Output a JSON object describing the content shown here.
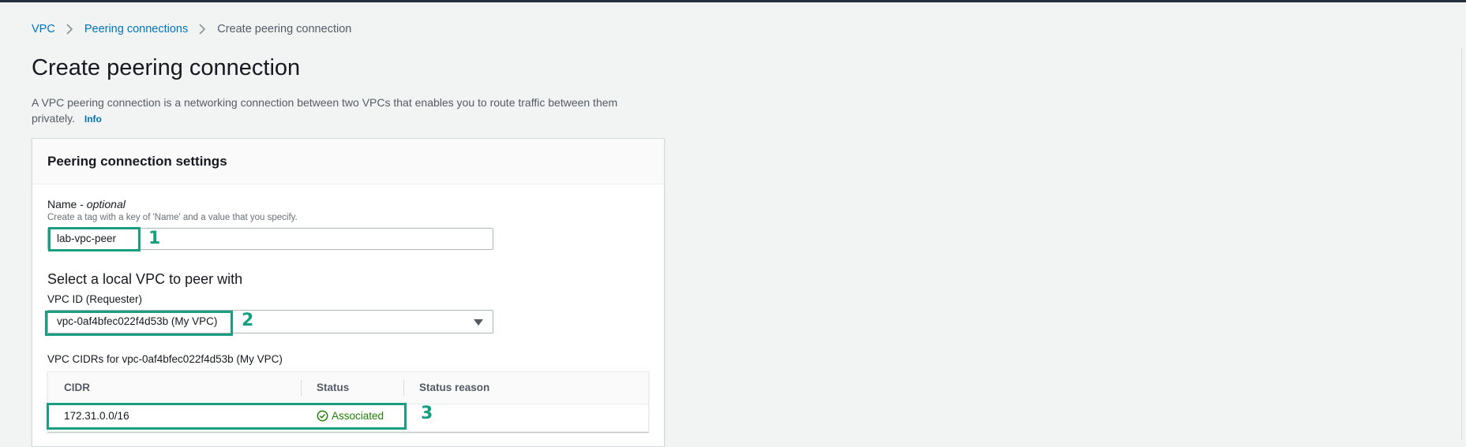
{
  "breadcrumb": {
    "items": [
      "VPC",
      "Peering connections"
    ],
    "current": "Create peering connection"
  },
  "page": {
    "title": "Create peering connection",
    "description": "A VPC peering connection is a networking connection between two VPCs that enables you to route traffic between them privately.",
    "info_link": "Info"
  },
  "panel": {
    "title": "Peering connection settings",
    "name_label": "Name - ",
    "name_optional": "optional",
    "name_hint": "Create a tag with a key of 'Name' and a value that you specify.",
    "name_value": "lab-vpc-peer",
    "local_vpc_heading": "Select a local VPC to peer with",
    "vpc_id_label": "VPC ID (Requester)",
    "vpc_id_value": "vpc-0af4bfec022f4d53b (My VPC)",
    "cidrs_label": "VPC CIDRs for vpc-0af4bfec022f4d53b (My VPC)",
    "table": {
      "headers": [
        "CIDR",
        "Status",
        "Status reason"
      ],
      "rows": [
        {
          "cidr": "172.31.0.0/16",
          "status": "Associated",
          "status_reason": ""
        }
      ]
    }
  },
  "annotations": [
    "1",
    "2",
    "3"
  ],
  "colors": {
    "annotation": "#1a9e82",
    "link": "#0073bb",
    "status_ok": "#1d8102",
    "topbar": "#232f3e"
  },
  "icons": [
    "chevron-right-icon",
    "caret-down-icon",
    "check-circle-icon"
  ]
}
